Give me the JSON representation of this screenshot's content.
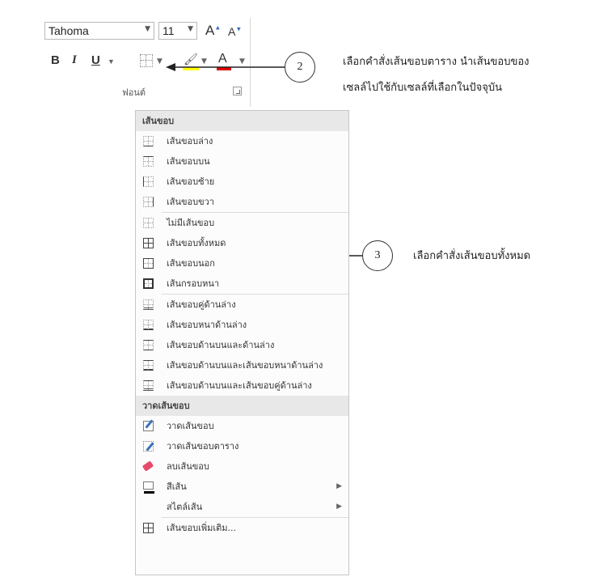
{
  "ribbon": {
    "font_name": "Tahoma",
    "font_size": "11",
    "grow_font": "A",
    "shrink_font": "A",
    "bold": "B",
    "italic": "I",
    "underline": "U",
    "font_color_letter": "A",
    "group_label": "ฟอนต์",
    "highlight_color": "#ffff00",
    "font_color": "#e00000"
  },
  "callouts": [
    {
      "number": "2",
      "line1": "เลือกคำสั่งเส้นขอบตาราง นำเส้นขอบของ",
      "line2": "เซลล์ไปใช้กับเซลล์ที่เลือกในปัจจุบัน"
    },
    {
      "number": "3",
      "line1": "เลือกคำสั่งเส้นขอบทั้งหมด"
    }
  ],
  "menu": {
    "header_borders": "เส้นขอบ",
    "header_draw": "วาดเส้นขอบ",
    "items": [
      {
        "label": "เส้นขอบล่าง",
        "icon": "bottom-border-icon"
      },
      {
        "label": "เส้นขอบบน",
        "icon": "top-border-icon"
      },
      {
        "label": "เส้นขอบซ้าย",
        "icon": "left-border-icon"
      },
      {
        "label": "เส้นขอบขวา",
        "icon": "right-border-icon"
      },
      {
        "label": "ไม่มีเส้นขอบ",
        "icon": "no-border-icon"
      },
      {
        "label": "เส้นขอบทั้งหมด",
        "icon": "all-borders-icon"
      },
      {
        "label": "เส้นขอบนอก",
        "icon": "outside-borders-icon"
      },
      {
        "label": "เส้นกรอบหนา",
        "icon": "thick-box-border-icon"
      },
      {
        "label": "เส้นขอบคู่ด้านล่าง",
        "icon": "bottom-double-border-icon"
      },
      {
        "label": "เส้นขอบหนาด้านล่าง",
        "icon": "thick-bottom-border-icon"
      },
      {
        "label": "เส้นขอบด้านบนและด้านล่าง",
        "icon": "top-bottom-border-icon"
      },
      {
        "label": "เส้นขอบด้านบนและเส้นขอบหนาด้านล่าง",
        "icon": "top-thick-bottom-border-icon"
      },
      {
        "label": "เส้นขอบด้านบนและเส้นขอบคู่ด้านล่าง",
        "icon": "top-double-bottom-border-icon"
      }
    ],
    "draw_items": [
      {
        "label": "วาดเส้นขอบ",
        "icon": "draw-border-icon"
      },
      {
        "label": "วาดเส้นขอบตาราง",
        "icon": "draw-border-grid-icon"
      },
      {
        "label": "ลบเส้นขอบ",
        "icon": "erase-border-icon"
      },
      {
        "label": "สีเส้น",
        "icon": "line-color-icon"
      },
      {
        "label": "สไตล์เส้น",
        "icon": "line-style-icon"
      }
    ],
    "more_borders": "เส้นขอบเพิ่มเติม..."
  }
}
